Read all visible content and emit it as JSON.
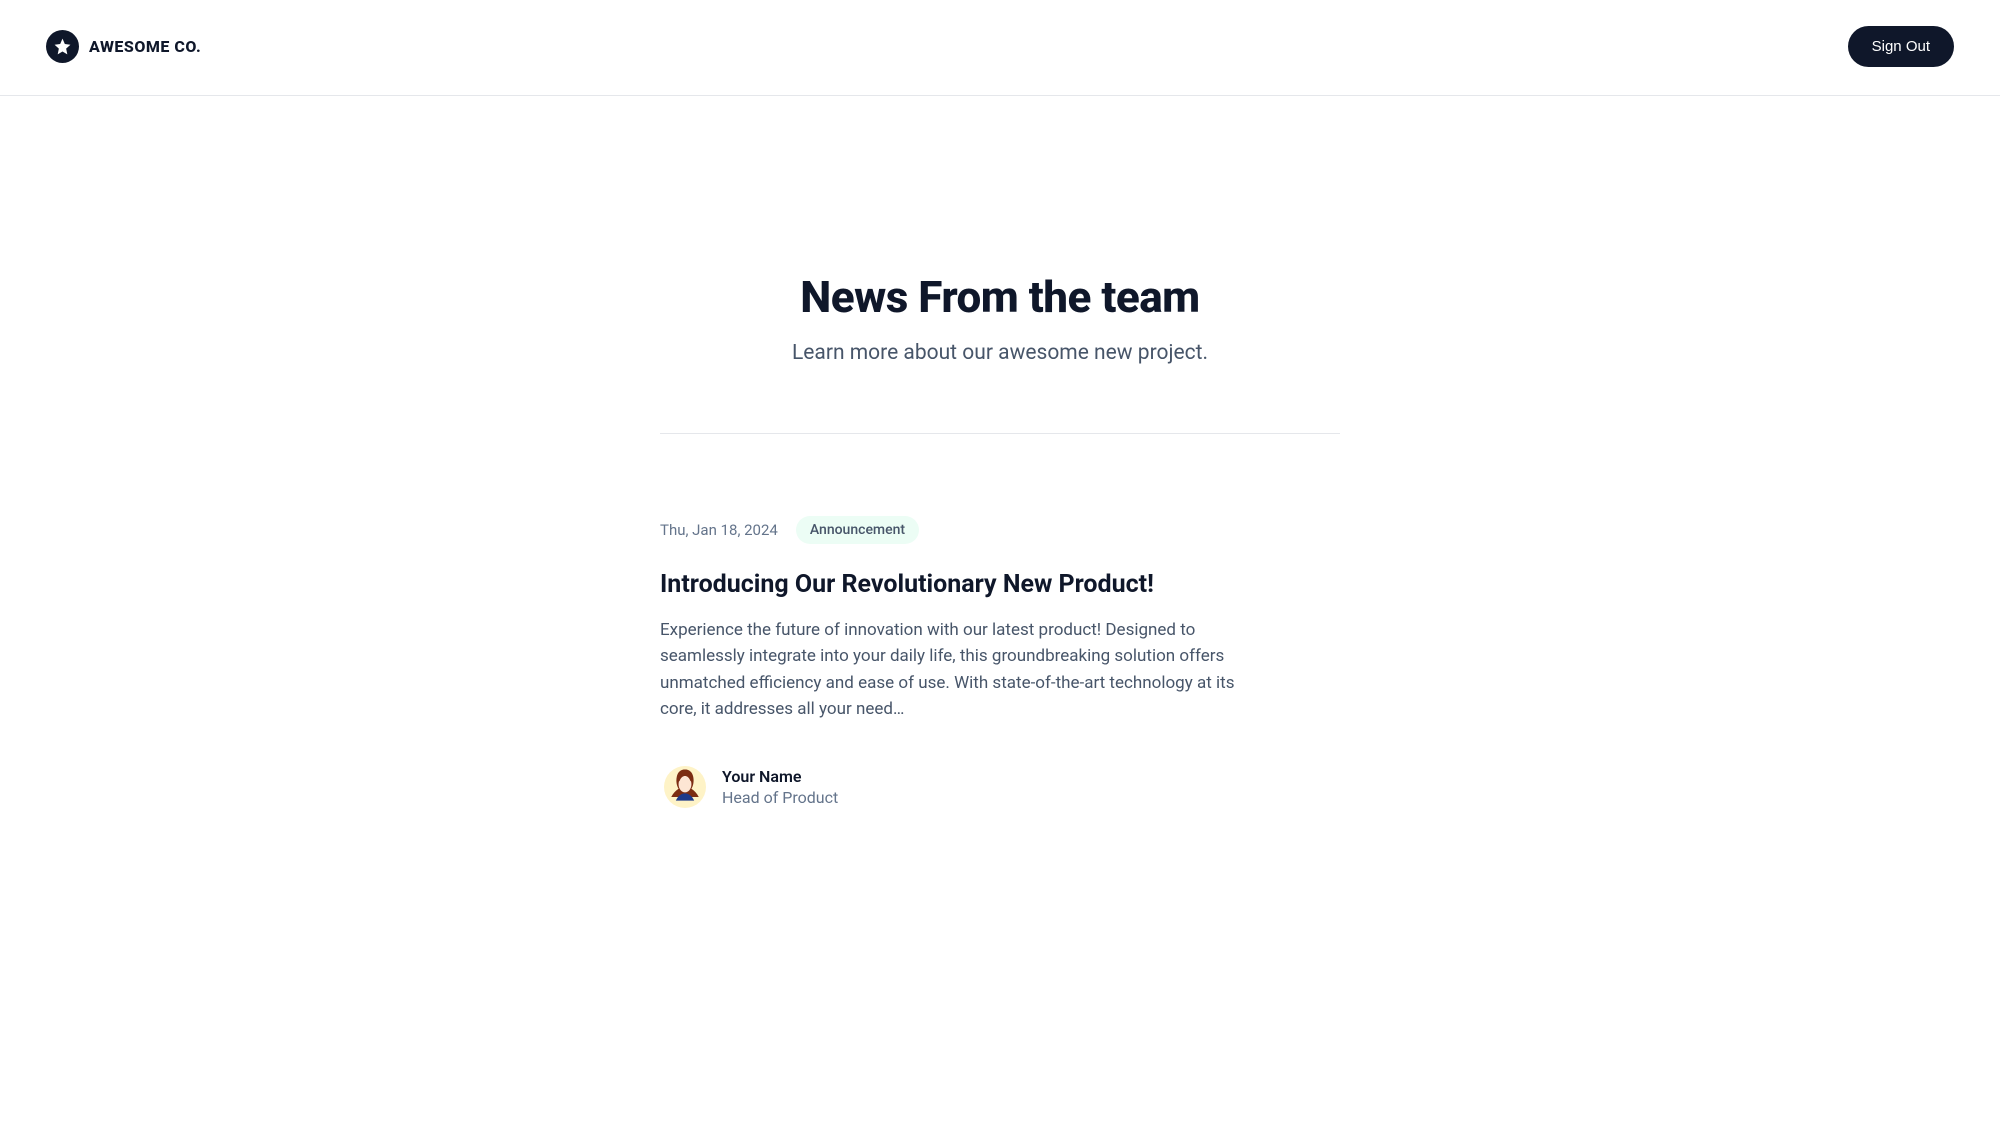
{
  "header": {
    "brand": "AWESOME CO.",
    "signout_label": "Sign Out"
  },
  "hero": {
    "title": "News From the team",
    "subtitle": "Learn more about our awesome new project."
  },
  "post": {
    "date": "Thu, Jan 18, 2024",
    "tag": "Announcement",
    "title": "Introducing Our Revolutionary New Product!",
    "summary": "Experience the future of innovation with our latest product! Designed to seamlessly integrate into your daily life, this groundbreaking solution offers unmatched efficiency and ease of use. With state-of-the-art technology at its core, it addresses all your need…",
    "author": {
      "name": "Your Name",
      "title": "Head of Product"
    }
  }
}
